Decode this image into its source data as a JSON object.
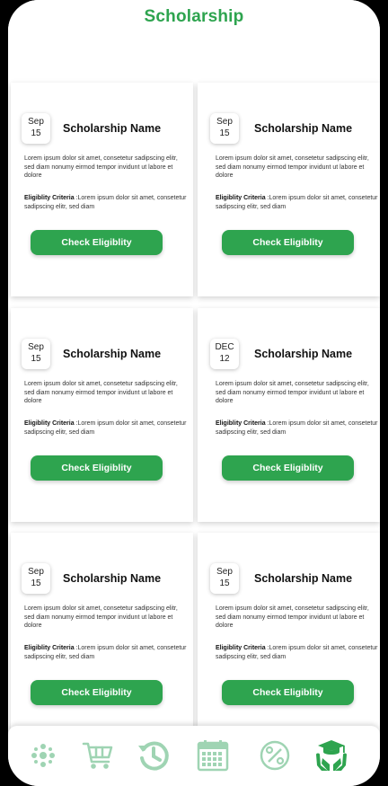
{
  "header": {
    "title": "Scholarship"
  },
  "cards": [
    {
      "month": "Sep",
      "day": "15",
      "name": "Scholarship Name",
      "description": "Lorem ipsum dolor sit amet, consetetur sadipscing elitr, sed diam nonumy eirmod tempor invidunt ut labore et dolore",
      "criteria_label": "Eligiblity Criteria",
      "criteria_text": " :Lorem ipsum dolor sit amet, consetetur sadipscing elitr, sed diam",
      "button": "Check Eligiblity"
    },
    {
      "month": "Sep",
      "day": "15",
      "name": "Scholarship Name",
      "description": "Lorem ipsum dolor sit amet, consetetur sadipscing elitr, sed diam nonumy eirmod tempor invidunt ut labore et dolore",
      "criteria_label": "Eligiblity Criteria",
      "criteria_text": " :Lorem ipsum dolor sit amet, consetetur sadipscing elitr, sed diam",
      "button": "Check Eligiblity"
    },
    {
      "month": "Sep",
      "day": "15",
      "name": "Scholarship Name",
      "description": "Lorem ipsum dolor sit amet, consetetur sadipscing elitr, sed diam nonumy eirmod tempor invidunt ut labore et dolore",
      "criteria_label": "Eligiblity Criteria",
      "criteria_text": " :Lorem ipsum dolor sit amet, consetetur sadipscing elitr, sed diam",
      "button": "Check Eligiblity"
    },
    {
      "month": "DEC",
      "day": "12",
      "name": "Scholarship Name",
      "description": "Lorem ipsum dolor sit amet, consetetur sadipscing elitr, sed diam nonumy eirmod tempor invidunt ut labore et dolore",
      "criteria_label": "Eligiblity Criteria",
      "criteria_text": " :Lorem ipsum dolor sit amet, consetetur sadipscing elitr, sed diam",
      "button": "Check Eligiblity"
    },
    {
      "month": "Sep",
      "day": "15",
      "name": "Scholarship Name",
      "description": "Lorem ipsum dolor sit amet, consetetur sadipscing elitr, sed diam nonumy eirmod tempor invidunt ut labore et dolore",
      "criteria_label": "Eligiblity Criteria",
      "criteria_text": " :Lorem ipsum dolor sit amet, consetetur sadipscing elitr, sed diam",
      "button": "Check Eligiblity"
    },
    {
      "month": "Sep",
      "day": "15",
      "name": "Scholarship Name",
      "description": "Lorem ipsum dolor sit amet, consetetur sadipscing elitr, sed diam nonumy eirmod tempor invidunt ut labore et dolore",
      "criteria_label": "Eligiblity Criteria",
      "criteria_text": " :Lorem ipsum dolor sit amet, consetetur sadipscing elitr, sed diam",
      "button": "Check Eligiblity"
    }
  ],
  "bottom_nav": {
    "items": [
      "network-icon",
      "cart-icon",
      "history-icon",
      "calendar-icon",
      "discount-icon",
      "scholarship-icon"
    ],
    "active": "scholarship-icon"
  },
  "colors": {
    "accent": "#2ea44f",
    "accent_light": "#a8dbb8"
  }
}
